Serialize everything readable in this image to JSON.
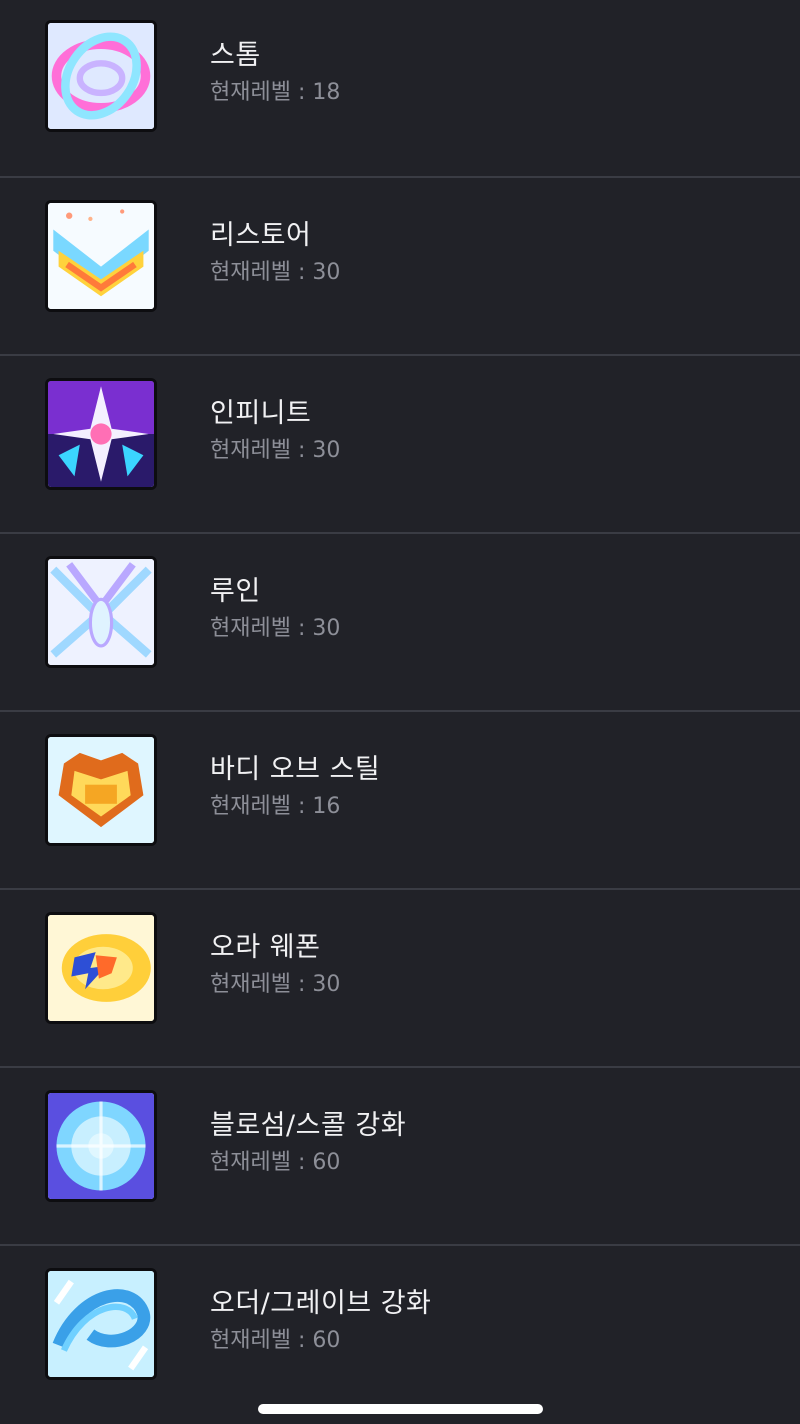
{
  "skills": [
    {
      "name": "스톰",
      "level_text": "현재레벨 : 18",
      "icon": "storm-icon",
      "colors": [
        "#ff6fd8",
        "#8fe6ff",
        "#c9b3ff"
      ]
    },
    {
      "name": "리스토어",
      "level_text": "현재레벨 : 30",
      "icon": "restore-icon",
      "colors": [
        "#ffd23c",
        "#ff7a3a",
        "#7ad8ff"
      ]
    },
    {
      "name": "인피니트",
      "level_text": "현재레벨 : 30",
      "icon": "infinite-icon",
      "colors": [
        "#7a2fd0",
        "#ff6fb5",
        "#3bd5ff"
      ]
    },
    {
      "name": "루인",
      "level_text": "현재레벨 : 30",
      "icon": "ruin-icon",
      "colors": [
        "#b9a8ff",
        "#dff3ff",
        "#9fd8ff"
      ]
    },
    {
      "name": "바디 오브 스틸",
      "level_text": "현재레벨 : 16",
      "icon": "body-of-steel-icon",
      "colors": [
        "#f5a623",
        "#ffd95a",
        "#e06b1c"
      ]
    },
    {
      "name": "오라 웨폰",
      "level_text": "현재레벨 : 30",
      "icon": "aura-weapon-icon",
      "colors": [
        "#ffcf3a",
        "#ff6a2a",
        "#2d4fd6"
      ]
    },
    {
      "name": "블로섬/스콜 강화",
      "level_text": "현재레벨 : 60",
      "icon": "blossom-squall-icon",
      "colors": [
        "#7fd6ff",
        "#5a4fe0",
        "#e0f7ff"
      ]
    },
    {
      "name": "오더/그레이브 강화",
      "level_text": "현재레벨 : 60",
      "icon": "order-grave-icon",
      "colors": [
        "#6fd0ff",
        "#c8f0ff",
        "#3aa0e8"
      ]
    }
  ]
}
